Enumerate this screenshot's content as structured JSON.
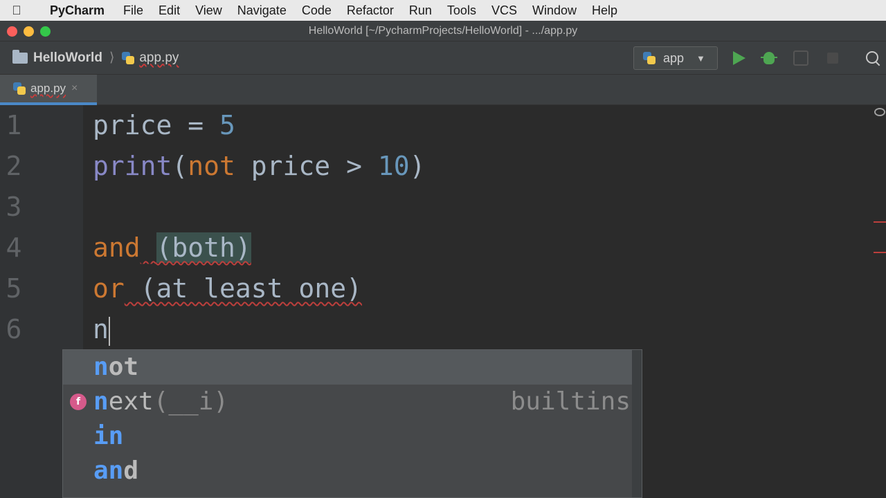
{
  "menubar": {
    "apple_icon": "apple-logo",
    "app_name": "PyCharm",
    "items": [
      "File",
      "Edit",
      "View",
      "Navigate",
      "Code",
      "Refactor",
      "Run",
      "Tools",
      "VCS",
      "Window",
      "Help"
    ]
  },
  "window": {
    "title": "HelloWorld [~/PycharmProjects/HelloWorld] - .../app.py"
  },
  "navbar": {
    "project": "HelloWorld",
    "file": "app.py",
    "run_config": "app"
  },
  "tabs": [
    {
      "label": "app.py",
      "close": "×",
      "active": true
    }
  ],
  "editor": {
    "lines": [
      {
        "no": "1"
      },
      {
        "no": "2"
      },
      {
        "no": "3"
      },
      {
        "no": "4"
      },
      {
        "no": "5"
      },
      {
        "no": "6"
      }
    ],
    "tokens": {
      "l1_var": "price",
      "l1_op": " = ",
      "l1_num": "5",
      "l2_fn": "print",
      "l2_open": "(",
      "l2_kw": "not",
      "l2_mid": " price > ",
      "l2_num": "10",
      "l2_close": ")",
      "l4_kw": "and",
      "l4_sp": " ",
      "l4_paren": "(both)",
      "l5_kw": "or",
      "l5_sp": " ",
      "l5_paren": "(at least one)",
      "l6_text": "n"
    }
  },
  "completion": {
    "items": [
      {
        "match": "n",
        "rest": "ot",
        "params": "",
        "type": "",
        "icon": ""
      },
      {
        "match": "n",
        "rest": "ext",
        "params": "(__i)",
        "type": "builtins",
        "icon": "f"
      },
      {
        "match": "in",
        "rest": "",
        "params": "",
        "type": "",
        "icon": ""
      },
      {
        "match": "an",
        "rest": "d",
        "params": "",
        "type": "",
        "icon": ""
      }
    ]
  },
  "colors": {
    "keyword": "#cc7832",
    "number": "#6897bb",
    "builtin": "#8888c6",
    "match": "#589df6",
    "run": "#4ea652"
  }
}
